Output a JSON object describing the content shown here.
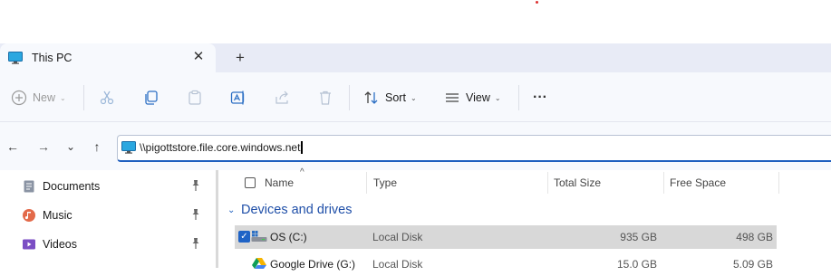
{
  "window": {
    "tab_title": "This PC",
    "tab_close": "✕",
    "new_tab": "+"
  },
  "toolbar": {
    "new_label": "New",
    "sort_label": "Sort",
    "view_label": "View",
    "more_label": "···"
  },
  "address": {
    "path": "\\\\pigottstore.file.core.windows.net"
  },
  "nav": {
    "back": "←",
    "forward": "→",
    "recent": "⌄",
    "up": "↑"
  },
  "sidebar": {
    "items": [
      {
        "label": "Documents",
        "icon": "documents-icon",
        "pinned": true
      },
      {
        "label": "Music",
        "icon": "music-icon",
        "pinned": true
      },
      {
        "label": "Videos",
        "icon": "videos-icon",
        "pinned": true
      }
    ]
  },
  "content": {
    "columns": {
      "name": "Name",
      "type": "Type",
      "total_size": "Total Size",
      "free_space": "Free Space"
    },
    "group": {
      "label": "Devices and drives",
      "chevron": "⌄"
    },
    "rows": [
      {
        "name": "OS (C:)",
        "type": "Local Disk",
        "total": "935 GB",
        "free": "498 GB",
        "selected": true
      },
      {
        "name": "Google Drive (G:)",
        "type": "Local Disk",
        "total": "15.0 GB",
        "free": "5.09 GB",
        "selected": false
      }
    ]
  },
  "colors": {
    "accent": "#1f5fbf",
    "tabbar": "#e8ebf6",
    "toolbar": "#f7f9fd",
    "selection": "#d8d8d8"
  }
}
